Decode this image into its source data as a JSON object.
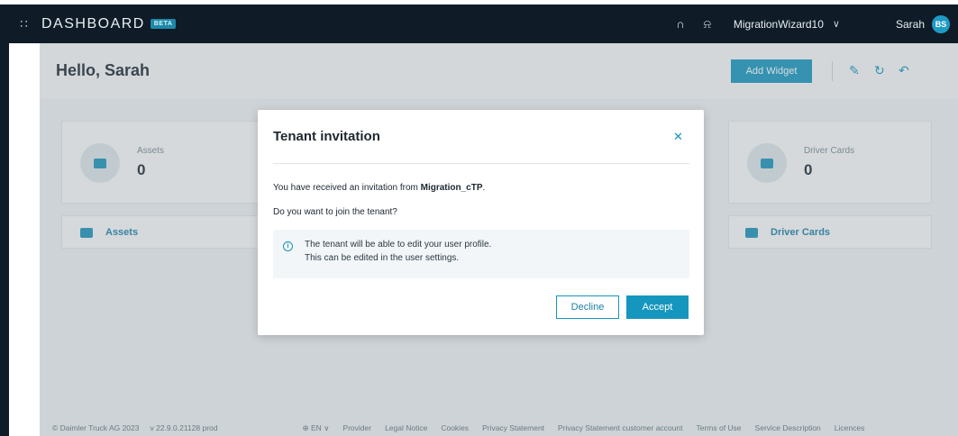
{
  "topbar": {
    "apps_icon": "apps-grid-icon",
    "brand": "DASHBOARD",
    "beta": "BETA",
    "support_icon": "headset-icon",
    "notification_icon": "bell-icon",
    "tenant": "MigrationWizard10",
    "user_name": "Sarah",
    "user_initials": "BS"
  },
  "page": {
    "greeting": "Hello, Sarah",
    "add_widget_label": "Add Widget",
    "edit_icon": "pencil-icon",
    "refresh_icon": "refresh-icon",
    "undo_icon": "undo-icon"
  },
  "widgets": {
    "assets": {
      "label": "Assets",
      "value": "0",
      "link": "Assets"
    },
    "driver_cards": {
      "label": "Driver Cards",
      "value": "0",
      "link": "Driver Cards"
    }
  },
  "modal": {
    "title": "Tenant invitation",
    "close_icon": "close-icon",
    "invite_prefix": "You have received an invitation from ",
    "invite_tenant": "Migration_cTP",
    "invite_suffix": ".",
    "question": "Do you want to join the tenant?",
    "info_line1": "The tenant will be able to edit your user profile.",
    "info_line2": "This can be edited in the user settings.",
    "decline_label": "Decline",
    "accept_label": "Accept"
  },
  "footer": {
    "copyright": "© Daimler Truck AG 2023",
    "version": "v 22.9.0.21128 prod",
    "language": "EN",
    "links": [
      "Provider",
      "Legal Notice",
      "Cookies",
      "Privacy Statement",
      "Privacy Statement customer account",
      "Terms of Use",
      "Service Description",
      "Licences"
    ]
  },
  "colors": {
    "topbar": "#0f1c27",
    "accent": "#1596be",
    "background": "#eef2f4"
  }
}
